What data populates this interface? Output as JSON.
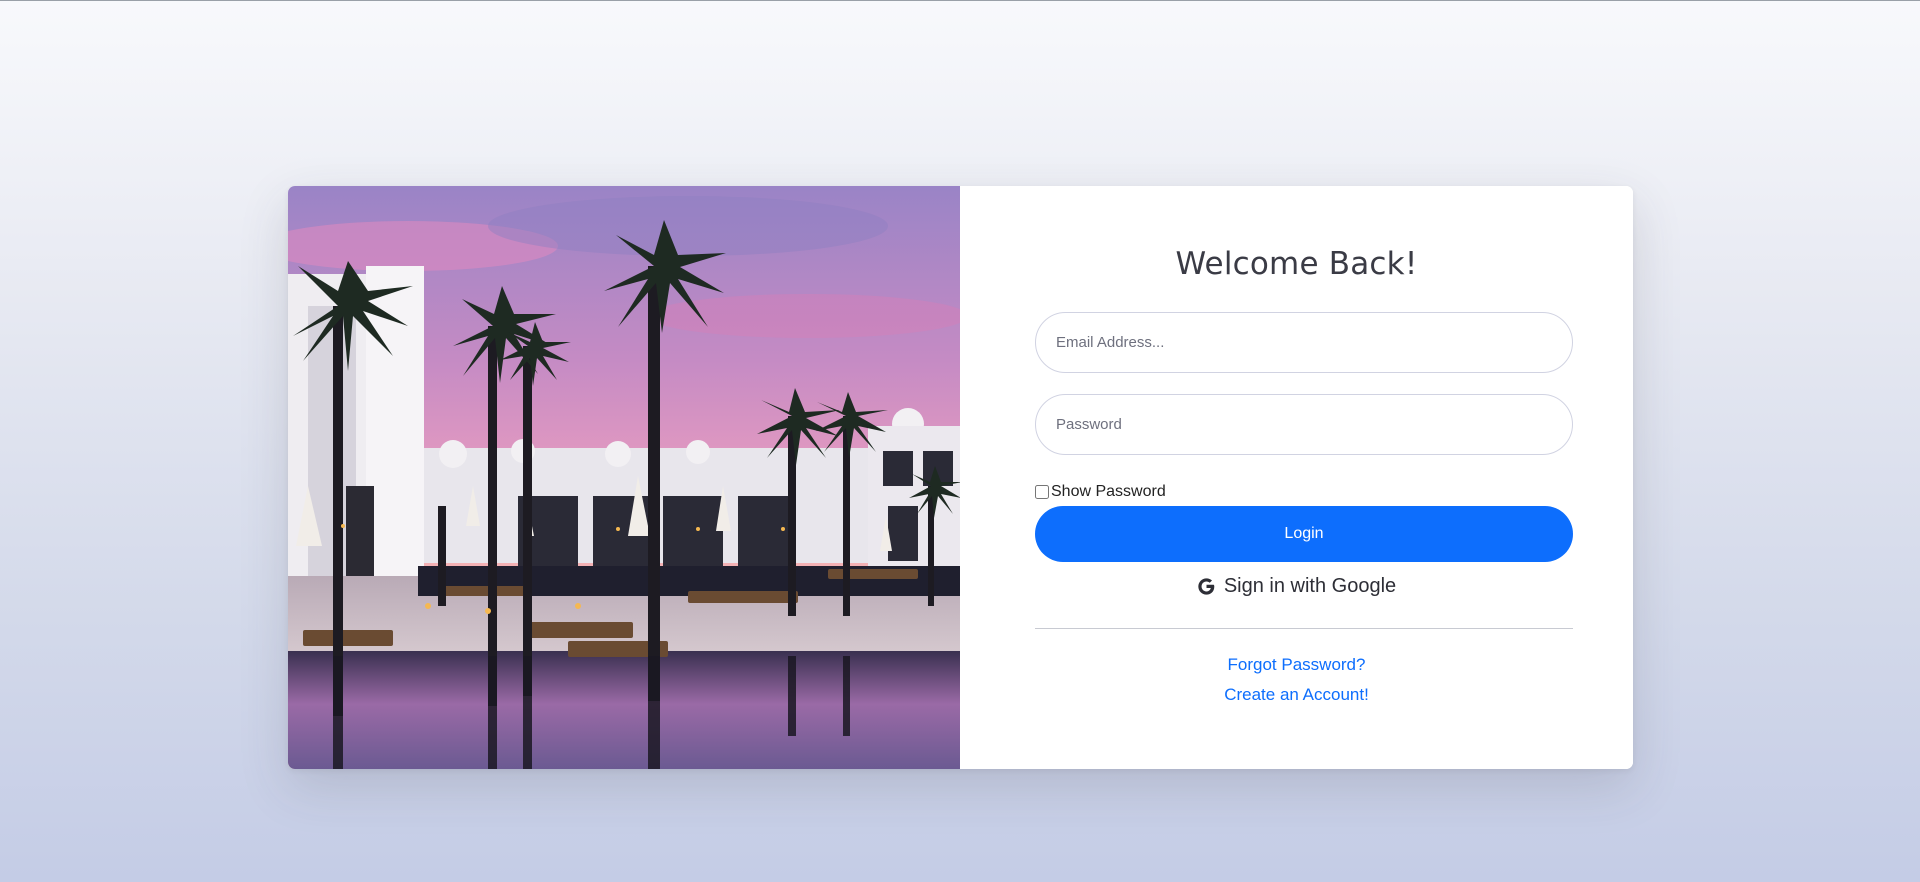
{
  "card": {
    "photo_alt": "Resort pool with palm trees at sunset",
    "title": "Welcome Back!",
    "email_placeholder": "Email Address...",
    "password_placeholder": "Password",
    "show_password_label": "Show Password",
    "show_password_checked": false,
    "login_label": "Login",
    "google_label": "Sign in with Google",
    "forgot_label": "Forgot Password?",
    "create_label": "Create an Account!"
  },
  "icons": {
    "google": "google-icon"
  },
  "colors": {
    "primary": "#0d6efd",
    "title": "#3a3b45",
    "divider": "#c8cad2",
    "background_top": "#f8f9fc",
    "background_bottom": "#c4cce6"
  }
}
